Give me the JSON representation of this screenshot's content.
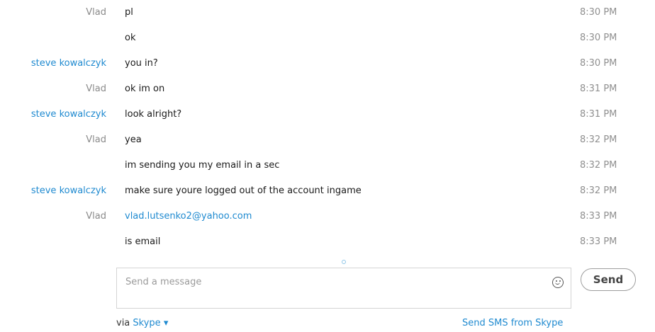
{
  "messages": [
    {
      "sender": "Vlad",
      "text": "pl",
      "time": "8:30 PM",
      "remote": false,
      "link": false
    },
    {
      "sender": "",
      "text": "ok",
      "time": "8:30 PM",
      "remote": false,
      "link": false
    },
    {
      "sender": "steve kowalczyk",
      "text": "you in?",
      "time": "8:30 PM",
      "remote": true,
      "link": false
    },
    {
      "sender": "Vlad",
      "text": "ok im on",
      "time": "8:31 PM",
      "remote": false,
      "link": false
    },
    {
      "sender": "steve kowalczyk",
      "text": "look alright?",
      "time": "8:31 PM",
      "remote": true,
      "link": false
    },
    {
      "sender": "Vlad",
      "text": "yea",
      "time": "8:32 PM",
      "remote": false,
      "link": false
    },
    {
      "sender": "",
      "text": "im sending you my email in a sec",
      "time": "8:32 PM",
      "remote": false,
      "link": false
    },
    {
      "sender": "steve kowalczyk",
      "text": "make sure youre logged out of the account ingame",
      "time": "8:32 PM",
      "remote": true,
      "link": false
    },
    {
      "sender": "Vlad",
      "text": "vlad.lutsenko2@yahoo.com",
      "time": "8:33 PM",
      "remote": false,
      "link": true
    },
    {
      "sender": "",
      "text": "is email",
      "time": "8:33 PM",
      "remote": false,
      "link": false
    }
  ],
  "composer": {
    "placeholder": "Send a message",
    "value": "",
    "emoji_icon": "smiley-icon",
    "send_label": "Send"
  },
  "footer": {
    "via_prefix": "via",
    "via_link": "Skype ▾",
    "sms_link": "Send SMS from Skype"
  },
  "colors": {
    "link": "#1f8ad0",
    "remote_sender": "#1f8ad0",
    "local_sender": "#8a8a8a",
    "time": "#8f8f8f"
  }
}
